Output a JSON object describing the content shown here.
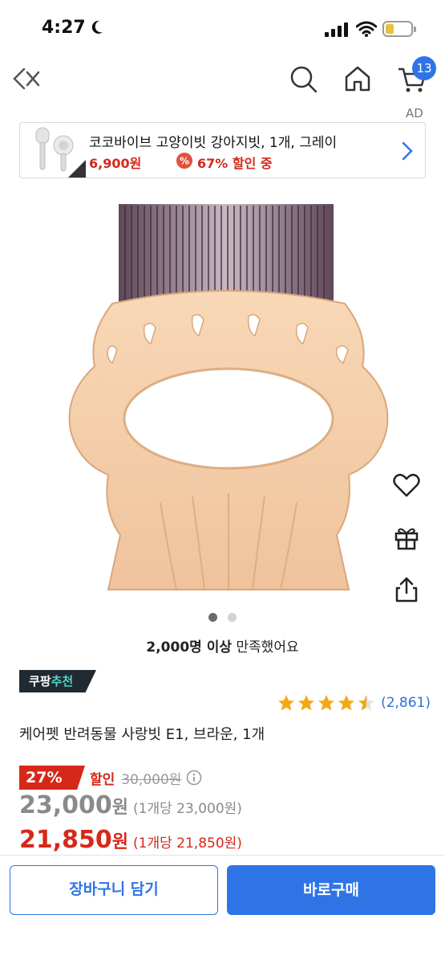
{
  "status_bar": {
    "time": "4:27"
  },
  "nav": {
    "cart_count": "13"
  },
  "ad": {
    "label": "AD",
    "title": "코코바이브 고양이빗 강아지빗, 1개, 그레이",
    "price": "6,900원",
    "discount": "67% 할인 중",
    "badge_glyph": "%"
  },
  "gallery": {
    "satisfaction_count": "2,000명 이상",
    "satisfaction_text": " 만족했어요",
    "page_count": 2,
    "current_page": 1
  },
  "product": {
    "badge_brand": "쿠팡",
    "badge_word": "추천",
    "rating": 4.5,
    "review_count": "(2,861)",
    "title": "케어펫 반려동물 사랑빗 E1, 브라운, 1개"
  },
  "pricing": {
    "discount_pct": "27%",
    "discount_word": "할인",
    "original_price": "30,000원",
    "sale_price_num": "23,000",
    "sale_price_won": "원",
    "sale_unit": "(1개당 23,000원)",
    "final_price_num": "21,850",
    "final_price_won": "원",
    "final_unit": "(1개당 21,850원)"
  },
  "actions": {
    "add_to_cart": "장바구니 담기",
    "buy_now": "바로구매"
  },
  "colors": {
    "accent": "#2f74e7",
    "sale": "#d6281a",
    "rating_star": "#f4a815",
    "link": "#2f6fd8"
  }
}
